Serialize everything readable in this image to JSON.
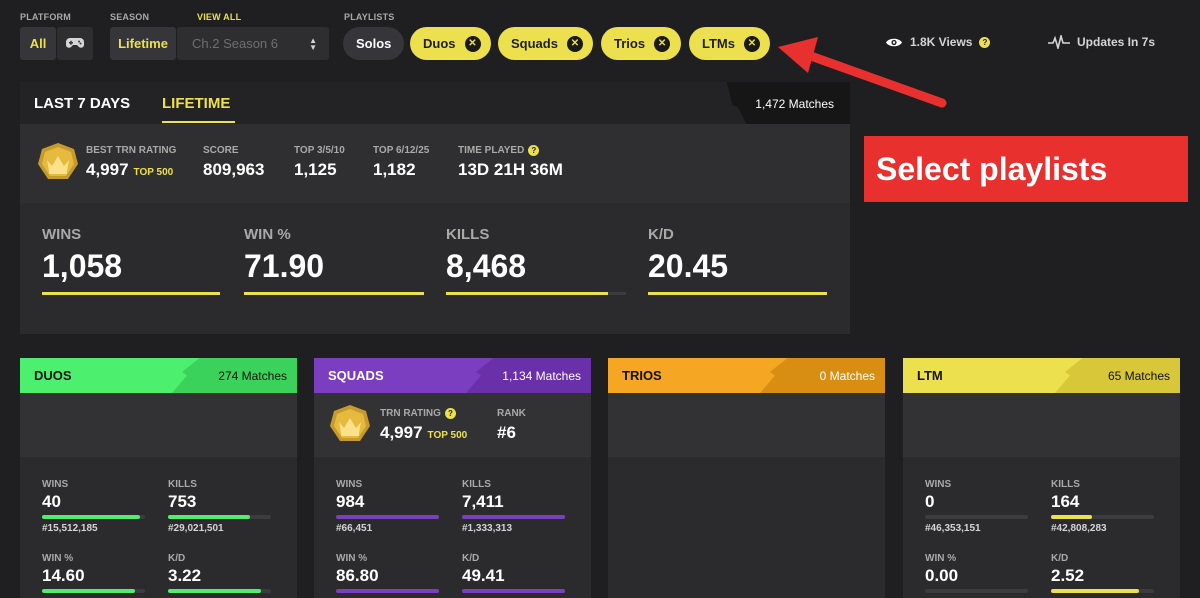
{
  "filters": {
    "platform_label": "PLATFORM",
    "season_label": "SEASON",
    "view_all": "VIEW ALL",
    "playlists_label": "PLAYLISTS",
    "platform_all": "All",
    "platform_controller_icon": "gamepad-icon",
    "season_lifetime": "Lifetime",
    "season_select_value": "Ch.2 Season 6",
    "playlists": [
      {
        "label": "Solos",
        "selected": false
      },
      {
        "label": "Duos",
        "selected": true
      },
      {
        "label": "Squads",
        "selected": true
      },
      {
        "label": "Trios",
        "selected": true
      },
      {
        "label": "LTMs",
        "selected": true
      }
    ]
  },
  "meta": {
    "views": "1.8K Views",
    "updates": "Updates In 7s"
  },
  "overview": {
    "tabs": [
      "LAST 7 DAYS",
      "LIFETIME"
    ],
    "active_tab": "LIFETIME",
    "matches": "1,472 Matches",
    "best_rating_label": "BEST TRN RATING",
    "best_rating_value": "4,997",
    "best_rating_tier": "TOP 500",
    "score_label": "SCORE",
    "score_value": "809,963",
    "top3510_label": "TOP 3/5/10",
    "top3510_value": "1,125",
    "top61225_label": "TOP 6/12/25",
    "top61225_value": "1,182",
    "time_played_label": "TIME PLAYED",
    "time_played_value": "13D 21H 36M",
    "big_stats": [
      {
        "label": "WINS",
        "value": "1,058",
        "fill": 1.0
      },
      {
        "label": "WIN %",
        "value": "71.90",
        "fill": 1.0
      },
      {
        "label": "KILLS",
        "value": "8,468",
        "fill": 0.9
      },
      {
        "label": "K/D",
        "value": "20.45",
        "fill": 1.0
      }
    ]
  },
  "cards": [
    {
      "name": "DUOS",
      "matches": "274 Matches",
      "color": "#4cf06e",
      "stripe": "#3ad25a",
      "bar": "#4cf06e",
      "name_color": "#111",
      "matches_color": "#111",
      "has_rating": false,
      "stats": [
        {
          "label": "WINS",
          "value": "40",
          "rank": "#15,512,185",
          "fill": 0.95
        },
        {
          "label": "KILLS",
          "value": "753",
          "rank": "#29,021,501",
          "fill": 0.8
        },
        {
          "label": "WIN %",
          "value": "14.60",
          "rank": "",
          "fill": 0.9
        },
        {
          "label": "K/D",
          "value": "3.22",
          "rank": "",
          "fill": 0.9
        }
      ]
    },
    {
      "name": "SQUADS",
      "matches": "1,134 Matches",
      "color": "#7c3ec0",
      "stripe": "#6a30a9",
      "bar": "#7c3ec0",
      "name_color": "#fff",
      "matches_color": "#fff",
      "has_rating": true,
      "rating_label": "TRN RATING",
      "rating_value": "4,997",
      "rating_tier": "TOP 500",
      "rank_label": "RANK",
      "rank_value": "#6",
      "stats": [
        {
          "label": "WINS",
          "value": "984",
          "rank": "#66,451",
          "fill": 1.0
        },
        {
          "label": "KILLS",
          "value": "7,411",
          "rank": "#1,333,313",
          "fill": 1.0
        },
        {
          "label": "WIN %",
          "value": "86.80",
          "rank": "",
          "fill": 1.0
        },
        {
          "label": "K/D",
          "value": "49.41",
          "rank": "",
          "fill": 1.0
        }
      ]
    },
    {
      "name": "TRIOS",
      "matches": "0 Matches",
      "color": "#f5a623",
      "stripe": "#d88e12",
      "bar": "#f5a623",
      "name_color": "#111",
      "matches_color": "#fff",
      "has_rating": false,
      "stats": []
    },
    {
      "name": "LTM",
      "matches": "65 Matches",
      "color": "#ece04e",
      "stripe": "#d9c73a",
      "bar": "#ece04e",
      "name_color": "#111",
      "matches_color": "#111",
      "has_rating": false,
      "stats": [
        {
          "label": "WINS",
          "value": "0",
          "rank": "#46,353,151",
          "fill": 0.0
        },
        {
          "label": "KILLS",
          "value": "164",
          "rank": "#42,808,283",
          "fill": 0.4
        },
        {
          "label": "WIN %",
          "value": "0.00",
          "rank": "",
          "fill": 0.0
        },
        {
          "label": "K/D",
          "value": "2.52",
          "rank": "",
          "fill": 0.85
        }
      ]
    }
  ],
  "annotation": {
    "callout_text": "Select playlists",
    "arrow_color": "#e8312f"
  },
  "colors": {
    "accent": "#ece04e",
    "background": "#1f1f21",
    "panel": "#2b2b2d"
  }
}
